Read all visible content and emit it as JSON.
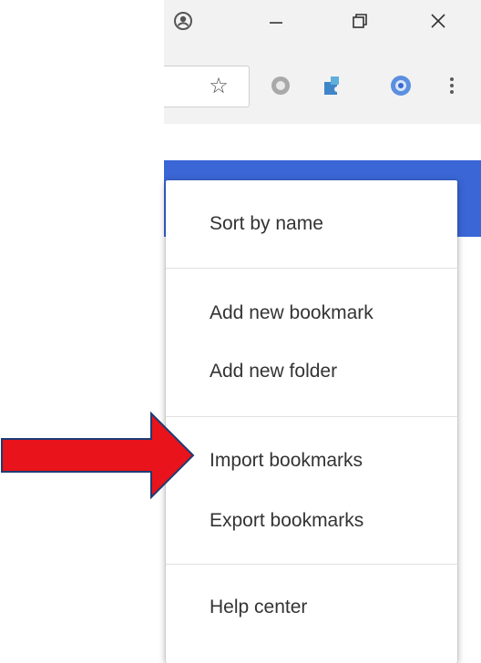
{
  "window_controls": {
    "profile": "profile-icon",
    "minimize": "minimize-icon",
    "restore": "restore-icon",
    "close": "close-icon"
  },
  "toolbar": {
    "star": "☆",
    "extensions": [
      "gray-circle-extension-icon",
      "puzzle-extension-icon",
      "blue-ring-extension-icon"
    ],
    "menu": "more-vert-icon"
  },
  "menu": {
    "items": [
      {
        "label": "Sort by name"
      },
      {
        "label": "Add new bookmark"
      },
      {
        "label": "Add new folder"
      },
      {
        "label": "Import bookmarks"
      },
      {
        "label": "Export bookmarks"
      },
      {
        "label": "Help center"
      }
    ]
  },
  "annotation": {
    "arrow_color": "#e8131b",
    "arrow_outline": "#1f3b73"
  },
  "colors": {
    "header_blue": "#3a66d6"
  }
}
